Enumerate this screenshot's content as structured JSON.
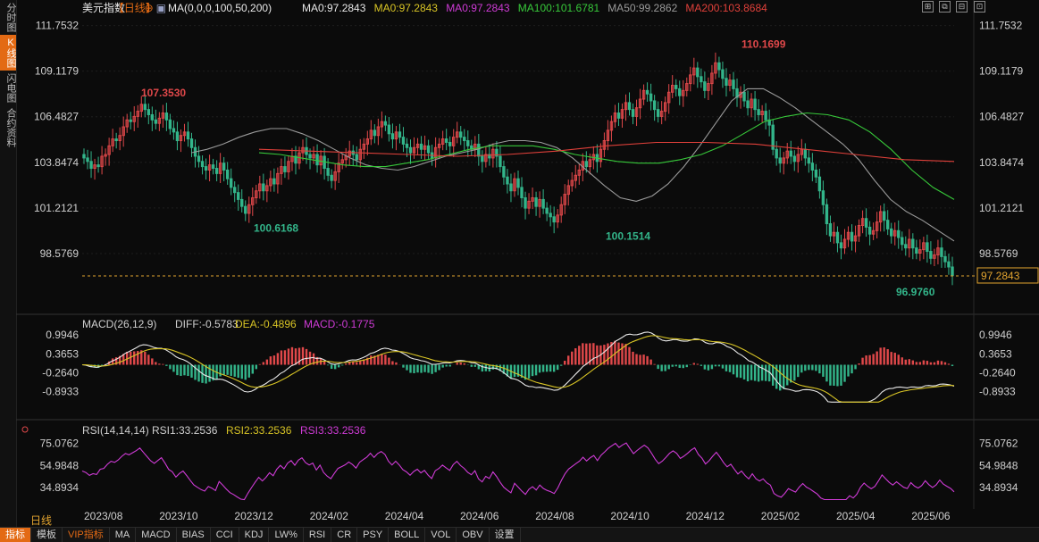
{
  "sidebar": {
    "tabs": [
      {
        "label": "分时图",
        "active": false
      },
      {
        "label": "K线图",
        "active": true
      },
      {
        "label": "闪电图",
        "active": false
      },
      {
        "label": "合约资料",
        "active": false
      }
    ]
  },
  "header": {
    "symbol": "美元指数",
    "period_tag": "【日线】",
    "ma_params": "MA(0,0,0,100,50,200)",
    "ma_values": [
      {
        "label": "MA0:97.2843",
        "color": "#e8e8e8"
      },
      {
        "label": "MA0:97.2843",
        "color": "#d8c425"
      },
      {
        "label": "MA0:97.2843",
        "color": "#cf3bd6"
      },
      {
        "label": "MA100:101.6781",
        "color": "#37c93a"
      },
      {
        "label": "MA50:99.2862",
        "color": "#9a9a9a"
      },
      {
        "label": "MA200:103.8684",
        "color": "#e0403a"
      }
    ]
  },
  "price_axis": {
    "ticks": [
      "111.7532",
      "109.1179",
      "106.4827",
      "103.8474",
      "101.2121",
      "98.5769"
    ],
    "current_price": "97.2843"
  },
  "annotations": {
    "high1": "107.3530",
    "low1": "100.6168",
    "low2": "100.1514",
    "high2": "110.1699",
    "low3": "96.9760"
  },
  "macd": {
    "title": "MACD(26,12,9)",
    "diff": "DIFF:-0.5783",
    "dea": "DEA:-0.4896",
    "macd": "MACD:-0.1775",
    "ticks": [
      "0.9946",
      "0.3653",
      "-0.2640",
      "-0.8933"
    ]
  },
  "rsi": {
    "title": "RSI(14,14,14)",
    "rsi1": "RSI1:33.2536",
    "rsi2": "RSI2:33.2536",
    "rsi3": "RSI3:33.2536",
    "ticks": [
      "75.0762",
      "54.9848",
      "34.8934"
    ]
  },
  "time_axis": [
    "2023/08",
    "2023/10",
    "2023/12",
    "2024/02",
    "2024/04",
    "2024/06",
    "2024/08",
    "2024/10",
    "2024/12",
    "2025/02",
    "2025/04",
    "2025/06"
  ],
  "period_label": "日线",
  "bottom_tabs": [
    {
      "label": "指标",
      "style": "active"
    },
    {
      "label": "模板",
      "style": ""
    },
    {
      "label": "VIP指标",
      "style": "vip"
    },
    {
      "label": "MA",
      "style": ""
    },
    {
      "label": "MACD",
      "style": ""
    },
    {
      "label": "BIAS",
      "style": ""
    },
    {
      "label": "CCI",
      "style": ""
    },
    {
      "label": "KDJ",
      "style": ""
    },
    {
      "label": "LW%",
      "style": ""
    },
    {
      "label": "RSI",
      "style": ""
    },
    {
      "label": "CR",
      "style": ""
    },
    {
      "label": "PSY",
      "style": ""
    },
    {
      "label": "BOLL",
      "style": ""
    },
    {
      "label": "VOL",
      "style": ""
    },
    {
      "label": "OBV",
      "style": ""
    },
    {
      "label": "设置",
      "style": ""
    }
  ],
  "chart_data": {
    "type": "candlestick",
    "title": "美元指数 日线",
    "price_range": [
      96.2,
      112.3
    ],
    "closes": [
      104.1,
      103.9,
      103.5,
      103.7,
      103.6,
      104.2,
      104.3,
      104.8,
      105.2,
      105.1,
      105.4,
      105.9,
      106.3,
      106.2,
      106.5,
      106.8,
      107.2,
      106.9,
      106.6,
      106.3,
      106.1,
      106.4,
      106.7,
      106.3,
      105.8,
      105.6,
      105.1,
      105.4,
      105.6,
      105.2,
      104.7,
      104.2,
      103.9,
      103.6,
      103.4,
      103.7,
      103.5,
      103.2,
      103.8,
      103.4,
      102.9,
      102.4,
      102.1,
      101.7,
      101.3,
      100.9,
      101.4,
      101.8,
      102.2,
      102.6,
      102.2,
      102.5,
      102.9,
      102.6,
      103.2,
      103.6,
      103.3,
      103.9,
      104.2,
      103.8,
      104.4,
      104.7,
      104.3,
      104.1,
      104.3,
      103.7,
      104.2,
      103.5,
      103.1,
      102.8,
      103.3,
      103.8,
      104.0,
      104.2,
      104.5,
      104.3,
      104.0,
      104.6,
      104.9,
      105.2,
      105.7,
      105.4,
      105.9,
      106.2,
      106.0,
      105.5,
      105.2,
      105.6,
      105.3,
      104.9,
      104.7,
      104.4,
      104.7,
      104.9,
      104.6,
      104.8,
      104.4,
      104.1,
      104.7,
      104.9,
      105.2,
      105.0,
      104.8,
      105.3,
      105.6,
      105.3,
      105.1,
      104.8,
      104.6,
      104.9,
      104.2,
      103.9,
      104.3,
      104.1,
      104.6,
      104.2,
      103.6,
      103.0,
      102.6,
      102.2,
      102.9,
      102.4,
      101.8,
      101.2,
      101.6,
      101.8,
      101.3,
      101.7,
      101.2,
      100.9,
      100.7,
      100.4,
      100.8,
      101.4,
      102.0,
      102.5,
      102.8,
      103.1,
      103.4,
      103.9,
      103.6,
      104.0,
      104.3,
      103.9,
      104.6,
      105.1,
      105.7,
      106.2,
      106.7,
      106.4,
      106.9,
      107.3,
      106.9,
      106.5,
      107.0,
      107.5,
      108.0,
      107.8,
      107.4,
      106.9,
      106.5,
      106.8,
      107.3,
      107.9,
      108.3,
      108.1,
      107.7,
      108.0,
      108.4,
      108.9,
      109.3,
      108.8,
      108.5,
      108.0,
      108.4,
      109.0,
      109.6,
      109.2,
      108.7,
      108.3,
      108.6,
      108.1,
      107.6,
      107.9,
      107.4,
      107.0,
      107.5,
      106.9,
      106.6,
      106.8,
      106.3,
      106.0,
      104.6,
      104.1,
      103.8,
      104.1,
      104.5,
      104.2,
      103.9,
      104.3,
      104.6,
      104.1,
      103.8,
      103.4,
      103.0,
      102.2,
      101.4,
      100.3,
      99.6,
      99.8,
      99.2,
      98.9,
      99.4,
      99.8,
      99.3,
      99.6,
      100.2,
      100.6,
      100.1,
      99.7,
      99.9,
      100.4,
      101.0,
      100.5,
      100.0,
      99.6,
      99.9,
      99.5,
      99.1,
      98.9,
      99.4,
      98.9,
      98.6,
      98.8,
      99.2,
      98.7,
      98.3,
      98.5,
      98.9,
      98.4,
      98.1,
      97.8,
      97.3
    ],
    "ma50": [
      104.4,
      104.6,
      104.9,
      105.3,
      105.6,
      105.8,
      105.8,
      105.5,
      105.1,
      104.6,
      104.1,
      103.7,
      103.5,
      103.4,
      103.6,
      103.9,
      104.2,
      104.4,
      104.6,
      104.9,
      105.1,
      105.1,
      105.0,
      104.7,
      104.1,
      103.3,
      102.5,
      101.8,
      101.6,
      101.9,
      102.6,
      103.6,
      104.8,
      106.1,
      107.4,
      108.1,
      108.1,
      107.6,
      107.0,
      106.3,
      105.6,
      104.9,
      104.0,
      102.8,
      101.7,
      101.0,
      100.5,
      99.9,
      99.3
    ],
    "ma100": [
      104.4,
      104.3,
      104.1,
      103.9,
      103.7,
      103.6,
      103.6,
      103.8,
      104.0,
      104.3,
      104.6,
      104.8,
      104.8,
      104.8,
      104.6,
      104.3,
      104.1,
      103.9,
      103.8,
      103.8,
      104.0,
      104.3,
      104.8,
      105.5,
      106.2,
      106.5,
      106.7,
      106.6,
      106.3,
      105.6,
      104.6,
      103.4,
      102.4,
      101.7
    ],
    "ma200": [
      104.6,
      104.5,
      104.4,
      104.3,
      104.2,
      104.3,
      104.5,
      104.8,
      105.0,
      105.0,
      104.9,
      104.6,
      104.3,
      104.0,
      103.9
    ],
    "price_ticks": [
      111.7532,
      109.1179,
      106.4827,
      103.8474,
      101.2121,
      98.5769
    ],
    "macd_range": [
      -1.3,
      1.3
    ],
    "macd_ticks": [
      0.9946,
      0.3653,
      -0.264,
      -0.8933
    ],
    "rsi_range": [
      22,
      82
    ],
    "rsi_ticks": [
      75.0762,
      54.9848,
      34.8934
    ]
  }
}
